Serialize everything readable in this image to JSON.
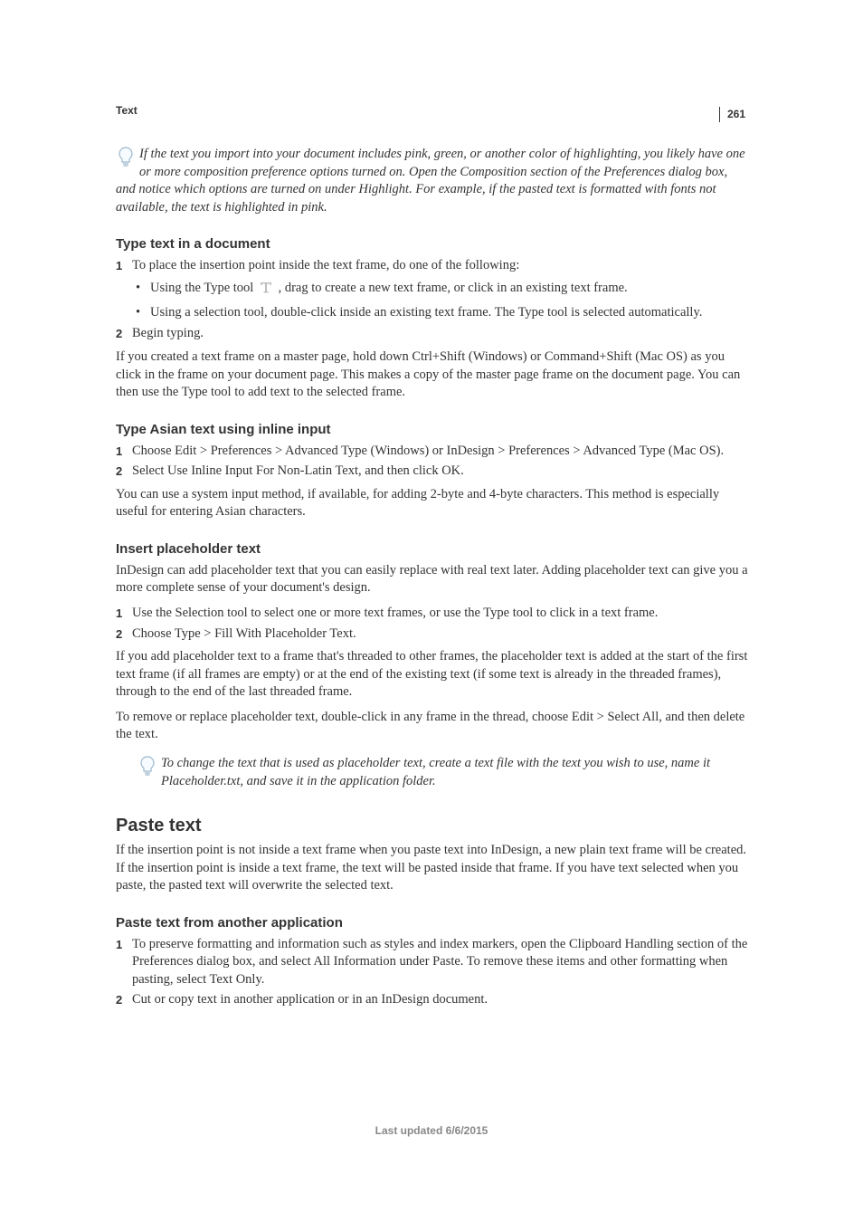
{
  "pageNumber": "261",
  "sectionLabel": "Text",
  "tip1": "If the text you import into your document includes pink, green, or another color of highlighting, you likely have one or more composition preference options turned on. Open the Composition section of the Preferences dialog box, and notice which options are turned on under Highlight. For example, if the pasted text is formatted with fonts not available, the text is highlighted in pink.",
  "s1": {
    "title": "Type text in a document",
    "step1": "To place the insertion point inside the text frame, do one of the following:",
    "bullet1a": "Using the Type tool ",
    "bullet1b": " , drag to create a new text frame, or click in an existing text frame.",
    "bullet2": "Using a selection tool, double-click inside an existing text frame. The Type tool is selected automatically.",
    "step2": "Begin typing.",
    "para": "If you created a text frame on a master page, hold down Ctrl+Shift (Windows) or Command+Shift (Mac OS) as you click in the frame on your document page. This makes a copy of the master page frame on the document page. You can then use the Type tool to add text to the selected frame."
  },
  "s2": {
    "title": "Type Asian text using inline input",
    "step1": "Choose Edit > Preferences > Advanced Type (Windows) or InDesign > Preferences > Advanced Type (Mac OS).",
    "step2": "Select Use Inline Input For Non-Latin Text, and then click OK.",
    "para": "You can use a system input method, if available, for adding 2-byte and 4-byte characters. This method is especially useful for entering Asian characters."
  },
  "s3": {
    "title": "Insert placeholder text",
    "intro": "InDesign can add placeholder text that you can easily replace with real text later. Adding placeholder text can give you a more complete sense of your document's design.",
    "step1": "Use the Selection tool to select one or more text frames, or use the Type tool to click in a text frame.",
    "step2": "Choose Type > Fill With Placeholder Text.",
    "para1": "If you add placeholder text to a frame that's threaded to other frames, the placeholder text is added at the start of the first text frame (if all frames are empty) or at the end of the existing text (if some text is already in the threaded frames), through to the end of the last threaded frame.",
    "para2": "To remove or replace placeholder text, double-click in any frame in the thread, choose Edit > Select All, and then delete the text.",
    "tip": "To change the text that is used as placeholder text, create a text file with the text you wish to use, name it Placeholder.txt, and save it in the application folder."
  },
  "s4": {
    "title": "Paste text",
    "intro": "If the insertion point is not inside a text frame when you paste text into InDesign, a new plain text frame will be created. If the insertion point is inside a text frame, the text will be pasted inside that frame. If you have text selected when you paste, the pasted text will overwrite the selected text.",
    "sub": {
      "title": "Paste text from another application",
      "step1": "To preserve formatting and information such as styles and index markers, open the Clipboard Handling section of the Preferences dialog box, and select All Information under Paste. To remove these items and other formatting when pasting, select Text Only.",
      "step2": "Cut or copy text in another application or in an InDesign document."
    }
  },
  "footer": "Last updated 6/6/2015"
}
